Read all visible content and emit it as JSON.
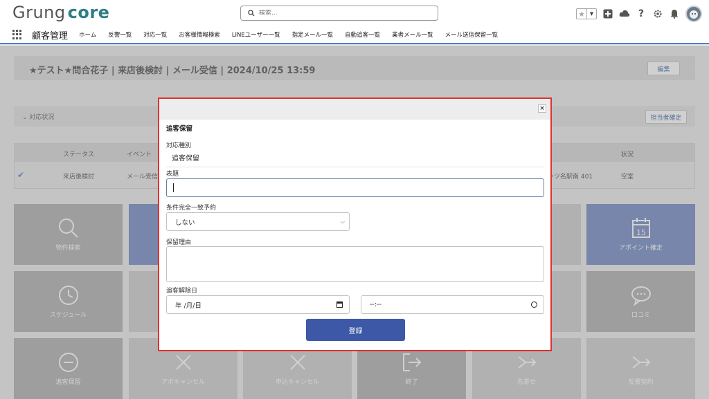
{
  "header": {
    "logo_text_1": "Grung",
    "logo_text_2": "core",
    "search_placeholder": "検索...",
    "icons": [
      "star-icon",
      "dropdown-icon",
      "add-icon",
      "cloud-icon",
      "help-icon",
      "settings-icon",
      "bell-icon",
      "avatar"
    ]
  },
  "nav": {
    "app_name": "顧客管理",
    "items": [
      "ホーム",
      "反響一覧",
      "対応一覧",
      "お客様情報検索",
      "LINEユーザー一覧",
      "指定メール一覧",
      "自動追客一覧",
      "業者メール一覧",
      "メール送信保留一覧"
    ]
  },
  "page": {
    "title": "★テスト★問合花子 | 来店後検討 | メール受信 | 2024/10/25 13:59",
    "edit_label": "編集",
    "section_label": "対応状況",
    "assign_label": "担当者確定",
    "table": {
      "headers": [
        "ステータス",
        "イベント",
        "状況"
      ],
      "row": {
        "status": "来店後検討",
        "event": "メール受信",
        "address": "ッツ名駅南 401",
        "condition": "空室"
      }
    },
    "tiles": {
      "property_search": "物件検索",
      "appointment": "アポイント確定",
      "schedule": "スケジュール",
      "review": "口コミ",
      "hold": "追客保留",
      "appo_cancel": "アポキャンセル",
      "apply_cancel": "申込キャンセル",
      "finish": "終了",
      "rename": "名寄せ",
      "contract": "反響契約",
      "calendar_day": "15"
    }
  },
  "modal": {
    "title": "追客保留",
    "type_label": "対応種別",
    "type_value": "追客保留",
    "subject_label": "表題",
    "subject_value": "",
    "match_label": "条件完全一致予約",
    "match_value": "しない",
    "reason_label": "保留理由",
    "reason_value": "",
    "release_label": "追客解除日",
    "date_placeholder": "年 /月/日",
    "time_placeholder": "--:--",
    "submit_label": "登録"
  }
}
